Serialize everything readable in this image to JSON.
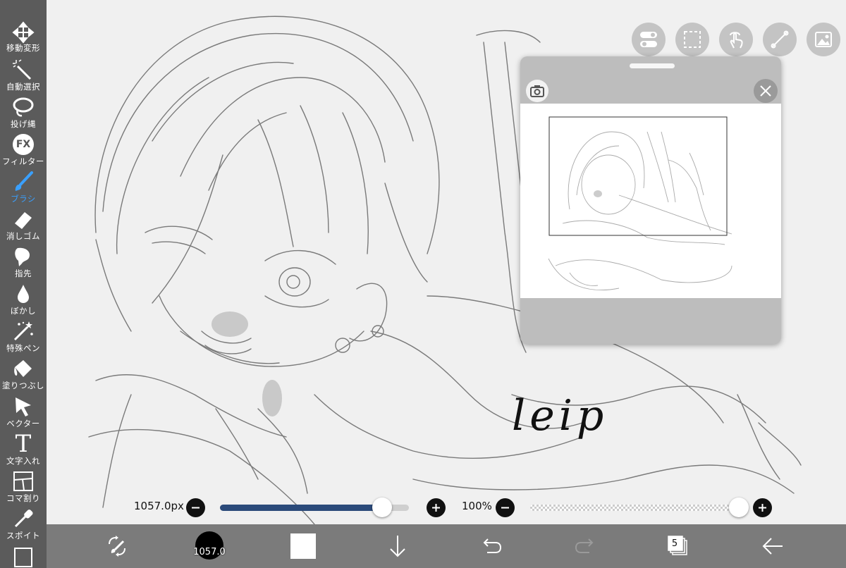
{
  "toolbar": {
    "tools": [
      {
        "label": "移動変形",
        "icon": "move-icon"
      },
      {
        "label": "自動選択",
        "icon": "magic-wand-icon"
      },
      {
        "label": "投げ縄",
        "icon": "lasso-icon"
      },
      {
        "label": "フィルター",
        "icon": "fx-icon",
        "icon_text": "FX"
      },
      {
        "label": "ブラシ",
        "icon": "brush-icon",
        "active": true
      },
      {
        "label": "消しゴム",
        "icon": "eraser-icon"
      },
      {
        "label": "指先",
        "icon": "smudge-icon"
      },
      {
        "label": "ぼかし",
        "icon": "blur-drop-icon"
      },
      {
        "label": "特殊ペン",
        "icon": "special-pen-icon"
      },
      {
        "label": "塗りつぶし",
        "icon": "fill-bucket-icon"
      },
      {
        "label": "ベクター",
        "icon": "vector-cursor-icon"
      },
      {
        "label": "文字入れ",
        "icon": "text-icon",
        "icon_text": "T"
      },
      {
        "label": "コマ割り",
        "icon": "frame-divider-icon"
      },
      {
        "label": "スポイト",
        "icon": "eyedropper-icon"
      }
    ]
  },
  "brush_size": {
    "value_text": "1057.0px",
    "fill": 0.86
  },
  "opacity": {
    "value_text": "100%",
    "fill": 1.0
  },
  "bottom_bar": {
    "brush_size_label": "1057.0",
    "layers_count": "5"
  },
  "canvas": {
    "signature_text": "leip"
  },
  "colors": {
    "accent": "#3aa0ff",
    "toolbar_bg": "#5b5b5b",
    "bottombar_bg": "#7b7b7b",
    "slider_fill": "#2b4a7a"
  }
}
